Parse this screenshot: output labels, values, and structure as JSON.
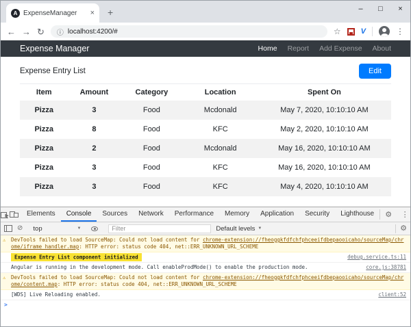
{
  "browser": {
    "tab_title": "ExpenseManager",
    "favicon_letter": "A",
    "url": "localhost:4200/#",
    "icons": {
      "back": "←",
      "forward": "→",
      "reload": "↻",
      "info": "ⓘ",
      "star": "☆",
      "menu": "⋮",
      "minimize": "–",
      "maximize": "□",
      "close": "×",
      "tab_close": "×",
      "new_tab": "+",
      "extension_v": "V"
    }
  },
  "navbar": {
    "brand": "Expense Manager",
    "items": [
      {
        "label": "Home",
        "active": true
      },
      {
        "label": "Report",
        "active": false
      },
      {
        "label": "Add Expense",
        "active": false
      },
      {
        "label": "About",
        "active": false
      }
    ]
  },
  "page": {
    "title": "Expense Entry List",
    "edit_button": "Edit"
  },
  "expense_table": {
    "headers": [
      "Item",
      "Amount",
      "Category",
      "Location",
      "Spent On"
    ],
    "rows": [
      [
        "Pizza",
        "3",
        "Food",
        "Mcdonald",
        "May 7, 2020, 10:10:10 AM"
      ],
      [
        "Pizza",
        "8",
        "Food",
        "KFC",
        "May 2, 2020, 10:10:10 AM"
      ],
      [
        "Pizza",
        "2",
        "Food",
        "Mcdonald",
        "May 16, 2020, 10:10:10 AM"
      ],
      [
        "Pizza",
        "3",
        "Food",
        "KFC",
        "May 16, 2020, 10:10:10 AM"
      ],
      [
        "Pizza",
        "3",
        "Food",
        "KFC",
        "May 4, 2020, 10:10:10 AM"
      ]
    ]
  },
  "devtools": {
    "tabs": [
      "Elements",
      "Console",
      "Sources",
      "Network",
      "Performance",
      "Memory",
      "Application",
      "Security",
      "Lighthouse"
    ],
    "active_tab": "Console",
    "toolbar": {
      "context": "top",
      "filter_placeholder": "Filter",
      "levels_label": "Default levels"
    },
    "icons": {
      "gear": "⚙",
      "kebab": "⋮",
      "close": "×",
      "clear": "⊘",
      "dropdown_arrow": "▼",
      "warning": "⚠",
      "prompt": ">"
    },
    "console_messages": [
      {
        "level": "warning",
        "text": "DevTools failed to load SourceMap: Could not load content for ",
        "link": "chrome-extension://fheoggkfdfchfphceeifdbepaooicaho/sourceMap/chrome/iframe_handler.map",
        "tail": ": HTTP error: status code 404, net::ERR_UNKNOWN_URL_SCHEME",
        "source": ""
      },
      {
        "level": "log",
        "highlight": true,
        "text": "Expense Entry List component initialized",
        "source": "debug.service.ts:11"
      },
      {
        "level": "log",
        "text": "Angular is running in the development mode. Call enableProdMode() to enable the production mode.",
        "source": "core.js:38781"
      },
      {
        "level": "warning",
        "text": "DevTools failed to load SourceMap: Could not load content for ",
        "link": "chrome-extension://fheoggkfdfchfphceeifdbepaooicaho/sourceMap/chrome/content.map",
        "tail": ": HTTP error: status code 404, net::ERR_UNKNOWN_URL_SCHEME",
        "source": ""
      },
      {
        "level": "log",
        "text": "[WDS] Live Reloading enabled.",
        "source": "client:52"
      }
    ]
  },
  "colors": {
    "accent_blue": "#007bff",
    "navbar_dark": "#343a40",
    "devtools_active_tab": "#1a73e8",
    "warning_bg": "#fffbe5",
    "warning_text": "#8a5700",
    "highlight_yellow": "#f9e231"
  }
}
